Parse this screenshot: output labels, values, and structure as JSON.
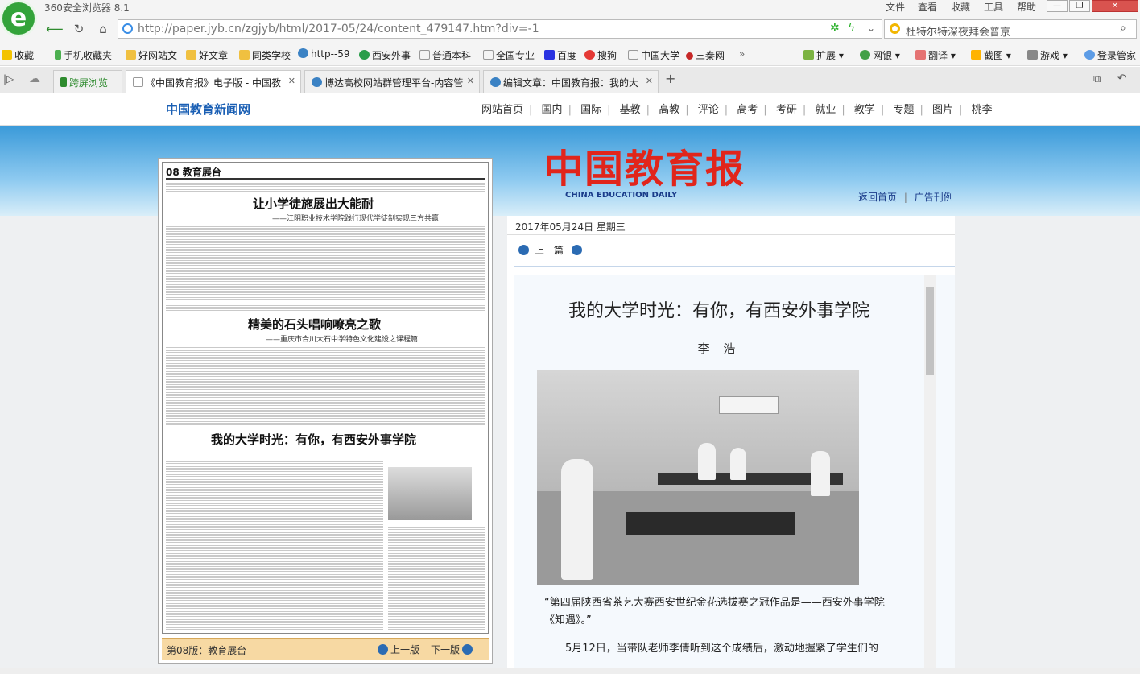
{
  "browser": {
    "app_title": "360安全浏览器 8.1",
    "menu": [
      "文件",
      "查看",
      "收藏",
      "工具",
      "帮助"
    ],
    "url": "http://paper.jyb.cn/zgjyb/html/2017-05/24/content_479147.htm?div=-1",
    "search_text": "杜特尔特深夜拜会普京",
    "bookmarks": [
      "收藏",
      "手机收藏夹",
      "好网站文",
      "好文章",
      "同类学校",
      "http--59",
      "西安外事",
      "普通本科",
      "全国专业",
      "百度",
      "搜狗",
      "中国大学",
      "三秦网"
    ],
    "toolbar_right": [
      "扩展",
      "网银",
      "翻译",
      "截图",
      "游戏",
      "登录管家"
    ],
    "tabs": [
      "跨屏浏览",
      "《中国教育报》电子版 - 中国教",
      "博达高校网站群管理平台-内容管",
      "编辑文章：中国教育报：我的大"
    ]
  },
  "site": {
    "logo_text": "中国教育新闻网",
    "nav": [
      "网站首页",
      "国内",
      "国际",
      "基教",
      "高教",
      "评论",
      "高考",
      "考研",
      "就业",
      "教学",
      "专题",
      "图片",
      "桃李"
    ],
    "masthead": "中国教育报",
    "masthead_sub": "CHINA EDUCATION DAILY",
    "links": [
      "返回首页",
      "广告刊例"
    ],
    "date": "2017年05月24日  星期三"
  },
  "page_thumb": {
    "section": "08 教育展台",
    "headline1": "让小学徒施展出大能耐",
    "sub1": "——江阴职业技术学院践行现代学徒制实现三方共赢",
    "headline2": "精美的石头唱响嘹亮之歌",
    "sub2": "——重庆市合川大石中学特色文化建设之课程篇",
    "headline3": "我的大学时光：有你，有西安外事学院",
    "footer_title": "第08版：教育展台",
    "prev": "上一版",
    "next": "下一版"
  },
  "article": {
    "prev_label": "上一篇",
    "title": "我的大学时光：有你，有西安外事学院",
    "author": "李 浩",
    "caption": "“第四届陕西省茶艺大赛西安世纪金花选拔赛之冠作品是——西安外事学院《知遇》。”",
    "para_start": "5月12日，当带队老师李倩听到这个成绩后，激动地握紧了学生们的"
  }
}
